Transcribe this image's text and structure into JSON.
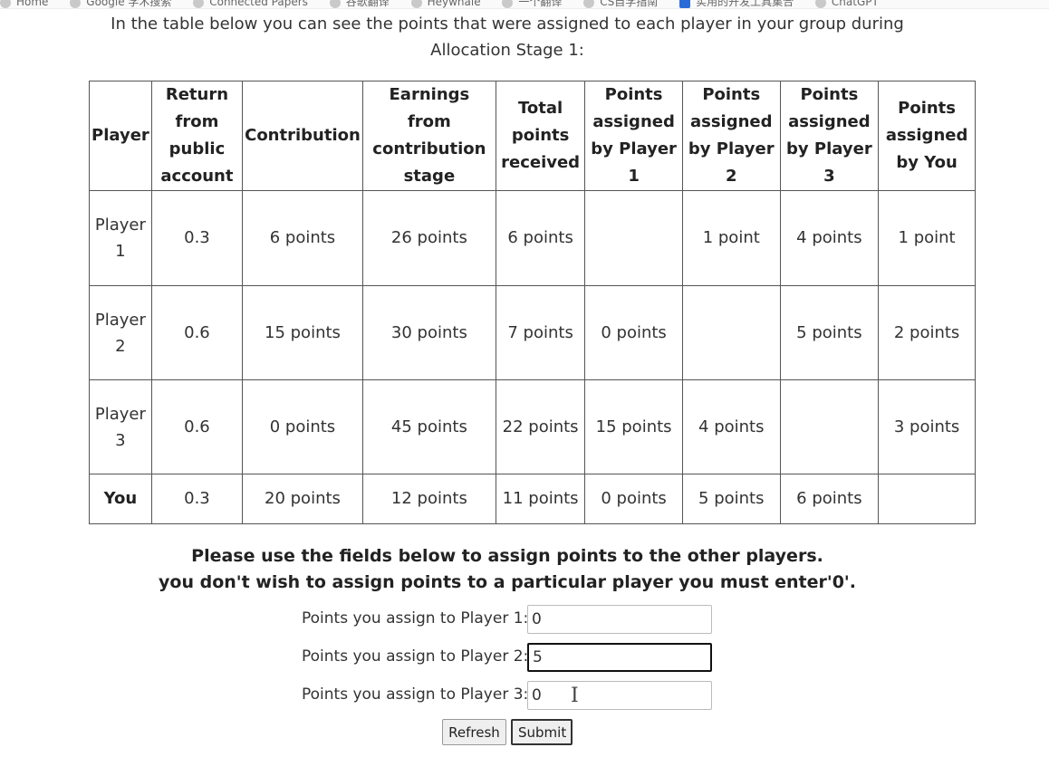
{
  "bookmarks": [
    "Home",
    "Google 学术搜索",
    "Connected Papers",
    "谷歌翻译",
    "Heywhale",
    "一个翻译",
    "CS自学指南",
    "实用的开发工具集合",
    "ChatGPT"
  ],
  "intro": {
    "line1": "In the table below you can see the points that were assigned to each player in your group during",
    "line2": "Allocation Stage 1:"
  },
  "table": {
    "headers": {
      "player": "Player",
      "return_public": "Return from public account",
      "contribution": "Contribution",
      "earnings": "Earnings from contribution stage",
      "total_received": "Total points received",
      "by_player1": "Points assigned by Player 1",
      "by_player2": "Points assigned by Player 2",
      "by_player3": "Points assigned by Player 3",
      "by_you": "Points assigned by You"
    },
    "rows": [
      {
        "player": "Player 1",
        "return_public": "0.3",
        "contribution": "6 points",
        "earnings": "26 points",
        "total_received": "6 points",
        "by_player1": "",
        "by_player2": "1 point",
        "by_player3": "4 points",
        "by_you": "1 point"
      },
      {
        "player": "Player 2",
        "return_public": "0.6",
        "contribution": "15 points",
        "earnings": "30 points",
        "total_received": "7 points",
        "by_player1": "0 points",
        "by_player2": "",
        "by_player3": "5 points",
        "by_you": "2 points"
      },
      {
        "player": "Player 3",
        "return_public": "0.6",
        "contribution": "0 points",
        "earnings": "45 points",
        "total_received": "22 points",
        "by_player1": "15 points",
        "by_player2": "4 points",
        "by_player3": "",
        "by_you": "3 points"
      },
      {
        "player": "You",
        "return_public": "0.3",
        "contribution": "20 points",
        "earnings": "12 points",
        "total_received": "11 points",
        "by_player1": "0 points",
        "by_player2": "5 points",
        "by_player3": "6 points",
        "by_you": ""
      }
    ]
  },
  "instructions": {
    "line1": "Please use the fields below to assign points to the other players.",
    "line2": "you don't wish to assign points to a particular player you must enter'0'."
  },
  "form": {
    "fields": [
      {
        "label": "Points you assign to Player 1:",
        "value": "0"
      },
      {
        "label": "Points you assign to Player 2:",
        "value": "5"
      },
      {
        "label": "Points you assign to Player 3:",
        "value": "0"
      }
    ],
    "refresh_label": "Refresh",
    "submit_label": "Submit"
  }
}
